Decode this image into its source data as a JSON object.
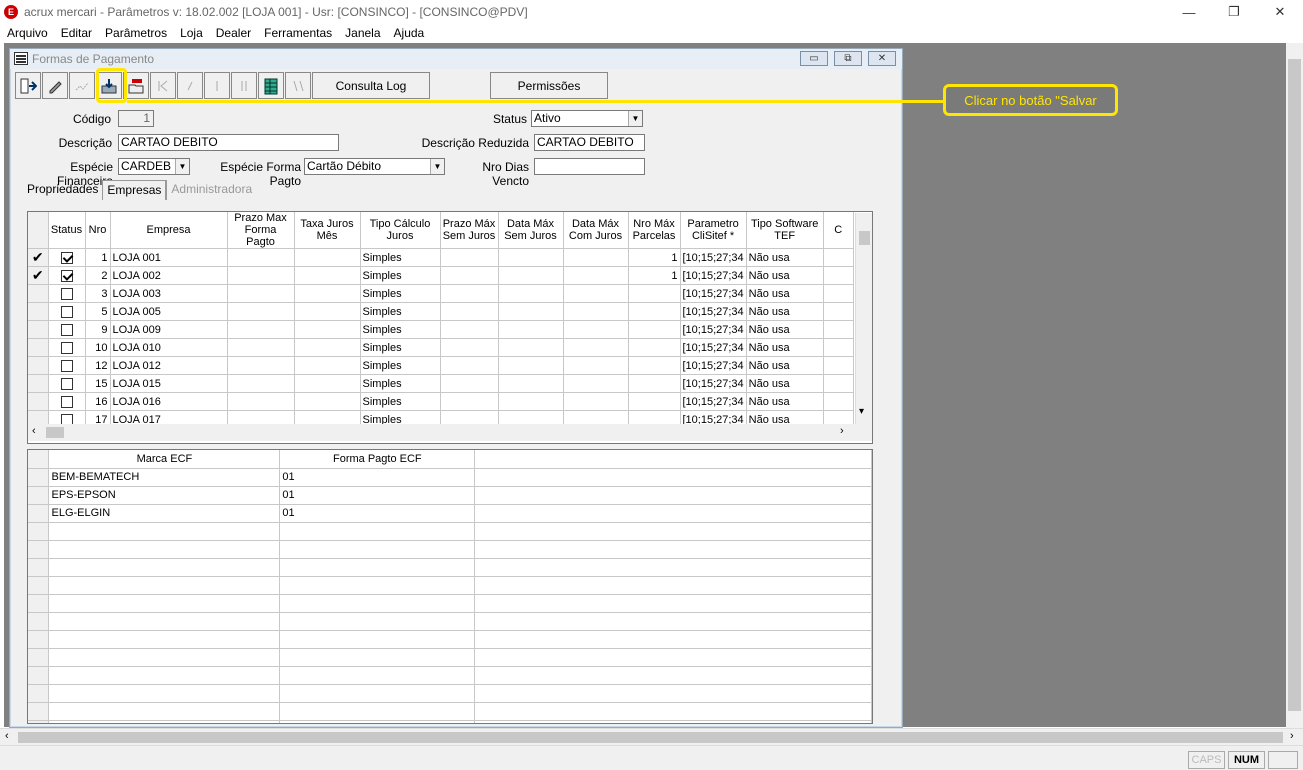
{
  "window": {
    "title": "acrux mercari - Parâmetros  v: 18.02.002  [LOJA 001] - Usr: [CONSINCO] - [CONSINCO@PDV]",
    "logo": "E",
    "minimize": "—",
    "restore": "❐",
    "close": "✕"
  },
  "menu": [
    "Arquivo",
    "Editar",
    "Parâmetros",
    "Loja",
    "Dealer",
    "Ferramentas",
    "Janela",
    "Ajuda"
  ],
  "child": {
    "title": "Formas de Pagamento",
    "minimize": "▭",
    "maximize": "⧉",
    "close": "✕"
  },
  "toolbar": {
    "consulta_log": "Consulta Log",
    "permissoes": "Permissões"
  },
  "form": {
    "codigo_label": "Código",
    "codigo_value": "1",
    "status_label": "Status",
    "status_value": "Ativo",
    "descricao_label": "Descrição",
    "descricao_value": "CARTAO DEBITO",
    "desc_reduzida_label": "Descrição Reduzida",
    "desc_reduzida_value": "CARTAO DEBITO",
    "especie_fin_label": "Espécie Financeira",
    "especie_fin_value": "CARDEB",
    "especie_forma_label": "Espécie Forma Pagto",
    "especie_forma_value": "Cartão Débito",
    "nro_dias_label": "Nro Dias Vencto",
    "nro_dias_value": ""
  },
  "tabs": [
    {
      "label": "Propriedades"
    },
    {
      "label": "Empresas"
    },
    {
      "label": "Administradora"
    }
  ],
  "empresas_grid": {
    "headers": [
      "Status",
      "Nro",
      "Empresa",
      "Prazo Max Forma Pagto",
      "Taxa Juros Mês",
      "Tipo Cálculo Juros",
      "Prazo Máx Sem Juros",
      "Data Máx Sem Juros",
      "Data Máx Com Juros",
      "Nro Máx Parcelas",
      "Parametro CliSitef *",
      "Tipo Software TEF",
      "C"
    ],
    "rows": [
      {
        "mark": "✔",
        "checked": true,
        "nro": "1",
        "empresa": "LOJA 001",
        "tipo": "Simples",
        "parcelas": "1",
        "param": "[10;15;27;34",
        "tef": "Não usa"
      },
      {
        "mark": "✔",
        "checked": true,
        "nro": "2",
        "empresa": "LOJA 002",
        "tipo": "Simples",
        "parcelas": "1",
        "param": "[10;15;27;34",
        "tef": "Não usa"
      },
      {
        "mark": "",
        "checked": false,
        "nro": "3",
        "empresa": "LOJA 003",
        "tipo": "Simples",
        "parcelas": "",
        "param": "[10;15;27;34",
        "tef": "Não usa"
      },
      {
        "mark": "",
        "checked": false,
        "nro": "5",
        "empresa": "LOJA 005",
        "tipo": "Simples",
        "parcelas": "",
        "param": "[10;15;27;34",
        "tef": "Não usa"
      },
      {
        "mark": "",
        "checked": false,
        "nro": "9",
        "empresa": "LOJA 009",
        "tipo": "Simples",
        "parcelas": "",
        "param": "[10;15;27;34",
        "tef": "Não usa"
      },
      {
        "mark": "",
        "checked": false,
        "nro": "10",
        "empresa": "LOJA 010",
        "tipo": "Simples",
        "parcelas": "",
        "param": "[10;15;27;34",
        "tef": "Não usa"
      },
      {
        "mark": "",
        "checked": false,
        "nro": "12",
        "empresa": "LOJA 012",
        "tipo": "Simples",
        "parcelas": "",
        "param": "[10;15;27;34",
        "tef": "Não usa"
      },
      {
        "mark": "",
        "checked": false,
        "nro": "15",
        "empresa": "LOJA 015",
        "tipo": "Simples",
        "parcelas": "",
        "param": "[10;15;27;34",
        "tef": "Não usa"
      },
      {
        "mark": "",
        "checked": false,
        "nro": "16",
        "empresa": "LOJA 016",
        "tipo": "Simples",
        "parcelas": "",
        "param": "[10;15;27;34",
        "tef": "Não usa"
      },
      {
        "mark": "",
        "checked": false,
        "nro": "17",
        "empresa": "LOJA 017",
        "tipo": "Simples",
        "parcelas": "",
        "param": "[10;15;27;34",
        "tef": "Não usa"
      }
    ]
  },
  "ecf_grid": {
    "headers": [
      "Marca ECF",
      "Forma Pagto ECF"
    ],
    "rows": [
      {
        "marca": "BEM-BEMATECH",
        "forma": "01"
      },
      {
        "marca": "EPS-EPSON",
        "forma": "01"
      },
      {
        "marca": "ELG-ELGIN",
        "forma": "01"
      }
    ],
    "empty_rows": 12
  },
  "callout": {
    "text": "Clicar no botão \"Salvar",
    "color": "#ffe600"
  },
  "statusbar": {
    "caps": "CAPS",
    "num": "NUM"
  }
}
